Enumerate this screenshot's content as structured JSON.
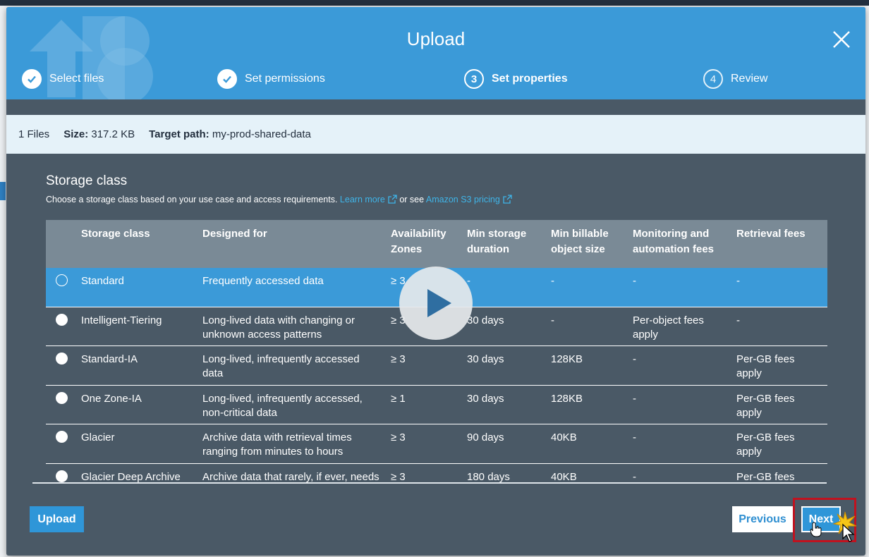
{
  "modal": {
    "title": "Upload",
    "steps": [
      {
        "number": "1",
        "label": "Select files",
        "state": "done"
      },
      {
        "number": "2",
        "label": "Set permissions",
        "state": "done"
      },
      {
        "number": "3",
        "label": "Set properties",
        "state": "current"
      },
      {
        "number": "4",
        "label": "Review",
        "state": "upcoming"
      }
    ],
    "close_icon": "close-icon"
  },
  "summary": {
    "files": "1 Files",
    "size_label": "Size:",
    "size_value": "317.2 KB",
    "target_label": "Target path:",
    "target_value": "my-prod-shared-data"
  },
  "storage": {
    "title": "Storage class",
    "description": "Choose a storage class based on your use case and access requirements.",
    "learn_more": "Learn more",
    "or_see": "or see",
    "pricing_link": "Amazon S3 pricing",
    "columns": {
      "storage_class": "Storage class",
      "designed_for": "Designed for",
      "az_line1": "Availability",
      "az_line2": "Zones",
      "min_dur_line1": "Min storage",
      "min_dur_line2": "duration",
      "min_size_line1": "Min billable",
      "min_size_line2": "object size",
      "monitoring_line1": "Monitoring and",
      "monitoring_line2": "automation fees",
      "retrieval": "Retrieval fees"
    },
    "rows": [
      {
        "name": "Standard",
        "designed_1": "Frequently accessed data",
        "designed_2": "",
        "az": "≥ 3",
        "duration": "-",
        "size": "-",
        "monitoring_1": "-",
        "monitoring_2": "",
        "retrieval_1": "-",
        "retrieval_2": "",
        "selected": true
      },
      {
        "name": "Intelligent-Tiering",
        "designed_1": "Long-lived data with changing or",
        "designed_2": "unknown access patterns",
        "az": "≥ 3",
        "duration": "30 days",
        "size": "-",
        "monitoring_1": "Per-object fees",
        "monitoring_2": "apply",
        "retrieval_1": "-",
        "retrieval_2": "",
        "selected": false
      },
      {
        "name": "Standard-IA",
        "designed_1": "Long-lived, infrequently accessed",
        "designed_2": "data",
        "az": "≥ 3",
        "duration": "30 days",
        "size": "128KB",
        "monitoring_1": "-",
        "monitoring_2": "",
        "retrieval_1": "Per-GB fees",
        "retrieval_2": "apply",
        "selected": false
      },
      {
        "name": "One Zone-IA",
        "designed_1": "Long-lived, infrequently accessed,",
        "designed_2": "non-critical data",
        "az": "≥ 1",
        "duration": "30 days",
        "size": "128KB",
        "monitoring_1": "-",
        "monitoring_2": "",
        "retrieval_1": "Per-GB fees",
        "retrieval_2": "apply",
        "selected": false
      },
      {
        "name": "Glacier",
        "designed_1": "Archive data with retrieval times",
        "designed_2": "ranging from minutes to hours",
        "az": "≥ 3",
        "duration": "90 days",
        "size": "40KB",
        "monitoring_1": "-",
        "monitoring_2": "",
        "retrieval_1": "Per-GB fees",
        "retrieval_2": "apply",
        "selected": false
      },
      {
        "name": "Glacier Deep Archive",
        "designed_1": "Archive data that rarely, if ever, needs",
        "designed_2": "",
        "az": "≥ 3",
        "duration": "180 days",
        "size": "40KB",
        "monitoring_1": "-",
        "monitoring_2": "",
        "retrieval_1": "Per-GB fees",
        "retrieval_2": "",
        "selected": false
      }
    ]
  },
  "footer": {
    "upload_label": "Upload",
    "previous_label": "Previous",
    "next_label": "Next"
  },
  "colors": {
    "header_blue": "#3b9ad8",
    "modal_body": "#4a5966",
    "table_header": "#7a8a96",
    "link": "#3fb5e9",
    "highlight": "#c1121f"
  }
}
